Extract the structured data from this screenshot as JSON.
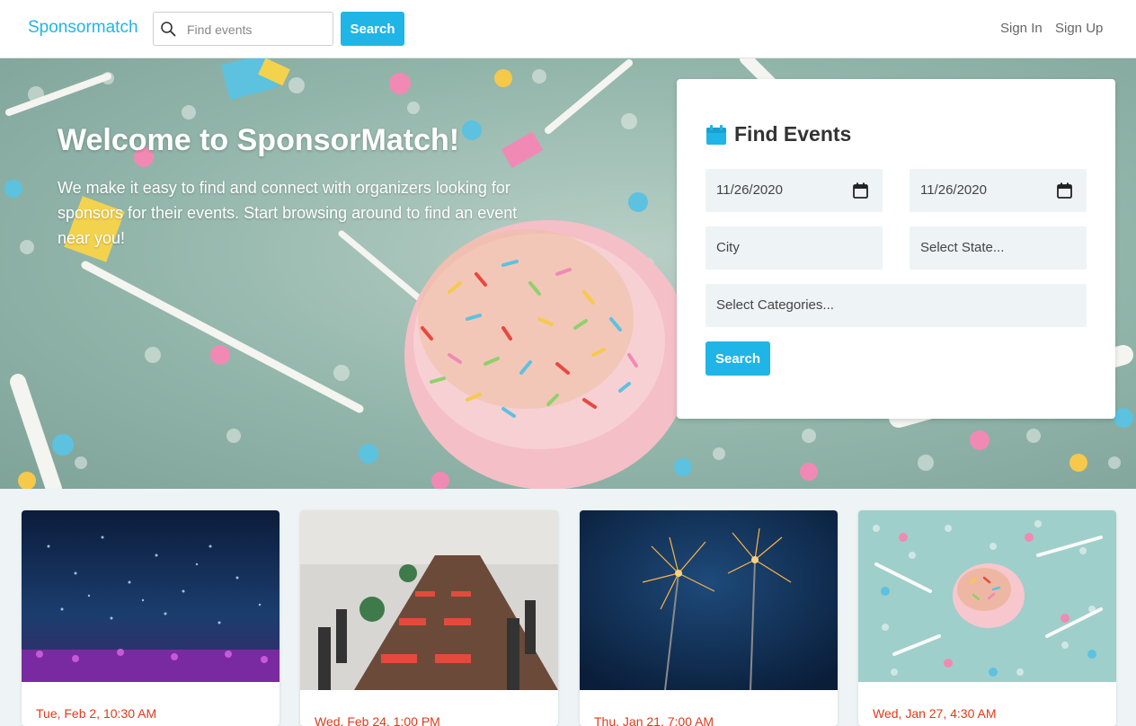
{
  "navbar": {
    "brand": "Sponsormatch",
    "search_placeholder": "Find events",
    "search_button": "Search",
    "sign_in": "Sign In",
    "sign_up": "Sign Up",
    "search_icon": "magnifier-icon"
  },
  "hero": {
    "title": "Welcome to SponsorMatch!",
    "subtitle": "We make it easy to find and connect with organizers looking for sponsors for their events. Start browsing around to find an event near you!"
  },
  "find_events": {
    "title": "Find Events",
    "icon": "calendar-icon",
    "start_date": "11/26/2020",
    "end_date": "11/26/2020",
    "city_placeholder": "City",
    "state_placeholder": "Select State...",
    "categories_placeholder": "Select Categories...",
    "search_button": "Search"
  },
  "events": [
    {
      "date": "Tue, Feb 2, 10:30 AM",
      "image": "confetti-concert-photo"
    },
    {
      "date": "Wed, Feb 24, 1:00 PM",
      "image": "banquet-table-photo"
    },
    {
      "date": "Thu, Jan 21, 7:00 AM",
      "image": "sparklers-photo"
    },
    {
      "date": "Wed, Jan 27, 4:30 AM",
      "image": "party-donut-photo"
    }
  ],
  "colors": {
    "accent": "#1fb5e6",
    "event_date": "#e03a1a",
    "page_bg": "#eef3f6"
  }
}
